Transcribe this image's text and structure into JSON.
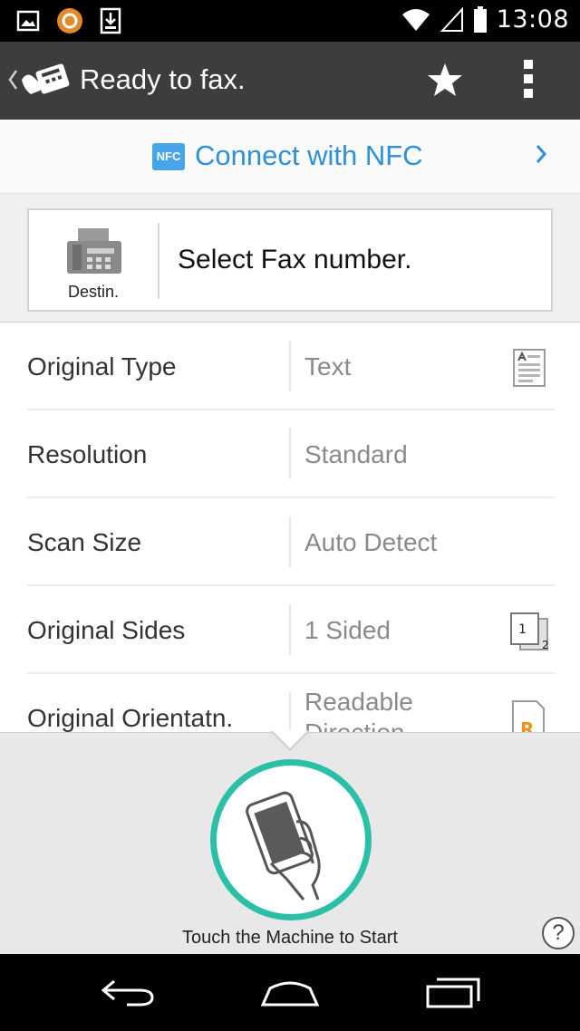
{
  "status_bar": {
    "time": "13:08",
    "icons": [
      "image-notification-icon",
      "app-notification-icon",
      "download-notification-icon",
      "wifi-icon",
      "signal-icon",
      "battery-icon"
    ]
  },
  "action_bar": {
    "title": "Ready to fax.",
    "icons": [
      "back-icon",
      "fax-app-logo",
      "star-icon",
      "overflow-menu-icon"
    ]
  },
  "nfc": {
    "badge": "NFC",
    "label": "Connect with NFC"
  },
  "destination": {
    "icon_label": "Destin.",
    "prompt": "Select Fax number."
  },
  "settings": [
    {
      "label": "Original Type",
      "value": "Text",
      "icon": "text-document-icon"
    },
    {
      "label": "Resolution",
      "value": "Standard",
      "icon": ""
    },
    {
      "label": "Scan Size",
      "value": "Auto Detect",
      "icon": ""
    },
    {
      "label": "Original Sides",
      "value": "1 Sided",
      "icon": "one-sided-icon"
    },
    {
      "label": "Original Orientatn.",
      "value_line1": "Readable",
      "value_line2": "Direction",
      "icon": "readable-direction-icon"
    }
  ],
  "touch": {
    "label": "Touch the Machine to Start",
    "accent_color": "#2bbfa8"
  },
  "help": {
    "label": "?"
  },
  "colors": {
    "action_bar_bg": "#3d3d3d",
    "nfc_text": "#2f8fd8",
    "accent": "#2bbfa8"
  }
}
